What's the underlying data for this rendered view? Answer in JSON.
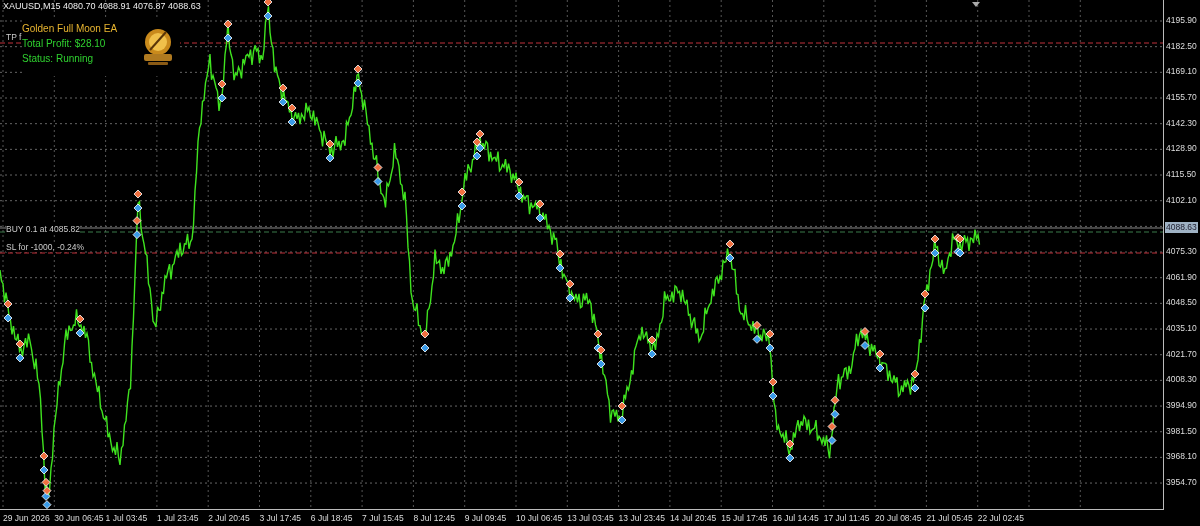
{
  "symbol_header": "XAUUSD,M15  4080.70 4088.91 4076.87 4088.63",
  "ea_panel": {
    "title": "Golden Full Moon EA",
    "profit": "Total Profit: $28.10",
    "status": "Status: Running"
  },
  "levels": [
    {
      "kind": "take_profit",
      "label": "TP f"
    },
    {
      "kind": "entry",
      "label": "BUY 0.1 at 4085.82"
    },
    {
      "kind": "stop_loss",
      "label": "SL for -1000, -0.24%"
    }
  ],
  "price_axis": [
    {
      "kind": "tick",
      "label": "4195.90"
    },
    {
      "kind": "tick",
      "label": "4182.50"
    },
    {
      "kind": "tick",
      "label": "4169.10"
    },
    {
      "kind": "tick",
      "label": "4155.70"
    },
    {
      "kind": "tick",
      "label": "4142.30"
    },
    {
      "kind": "tick",
      "label": "4128.90"
    },
    {
      "kind": "tick",
      "label": "4115.50"
    },
    {
      "kind": "tick",
      "label": "4102.10"
    },
    {
      "kind": "current",
      "label": "4088.63"
    },
    {
      "kind": "tick",
      "label": "4075.30"
    },
    {
      "kind": "tick",
      "label": "4061.90"
    },
    {
      "kind": "tick",
      "label": "4048.50"
    },
    {
      "kind": "tick",
      "label": "4035.10"
    },
    {
      "kind": "tick",
      "label": "4021.70"
    },
    {
      "kind": "tick",
      "label": "4008.30"
    },
    {
      "kind": "tick",
      "label": "3994.90"
    },
    {
      "kind": "tick",
      "label": "3981.50"
    },
    {
      "kind": "tick",
      "label": "3968.10"
    },
    {
      "kind": "tick",
      "label": "3954.70"
    }
  ],
  "time_axis": [
    "29 Jun 2026",
    "30 Jun 06:45",
    "1 Jul 03:45",
    "1 Jul 23:45",
    "2 Jul 20:45",
    "3 Jul 17:45",
    "6 Jul 18:45",
    "7 Jul 15:45",
    "8 Jul 12:45",
    "9 Jul 09:45",
    "10 Jul 06:45",
    "13 Jul 03:45",
    "13 Jul 23:45",
    "14 Jul 20:45",
    "15 Jul 17:45",
    "16 Jul 14:45",
    "17 Jul 11:45",
    "20 Jul 08:45",
    "21 Jul 05:45",
    "22 Jul 02:45"
  ]
}
